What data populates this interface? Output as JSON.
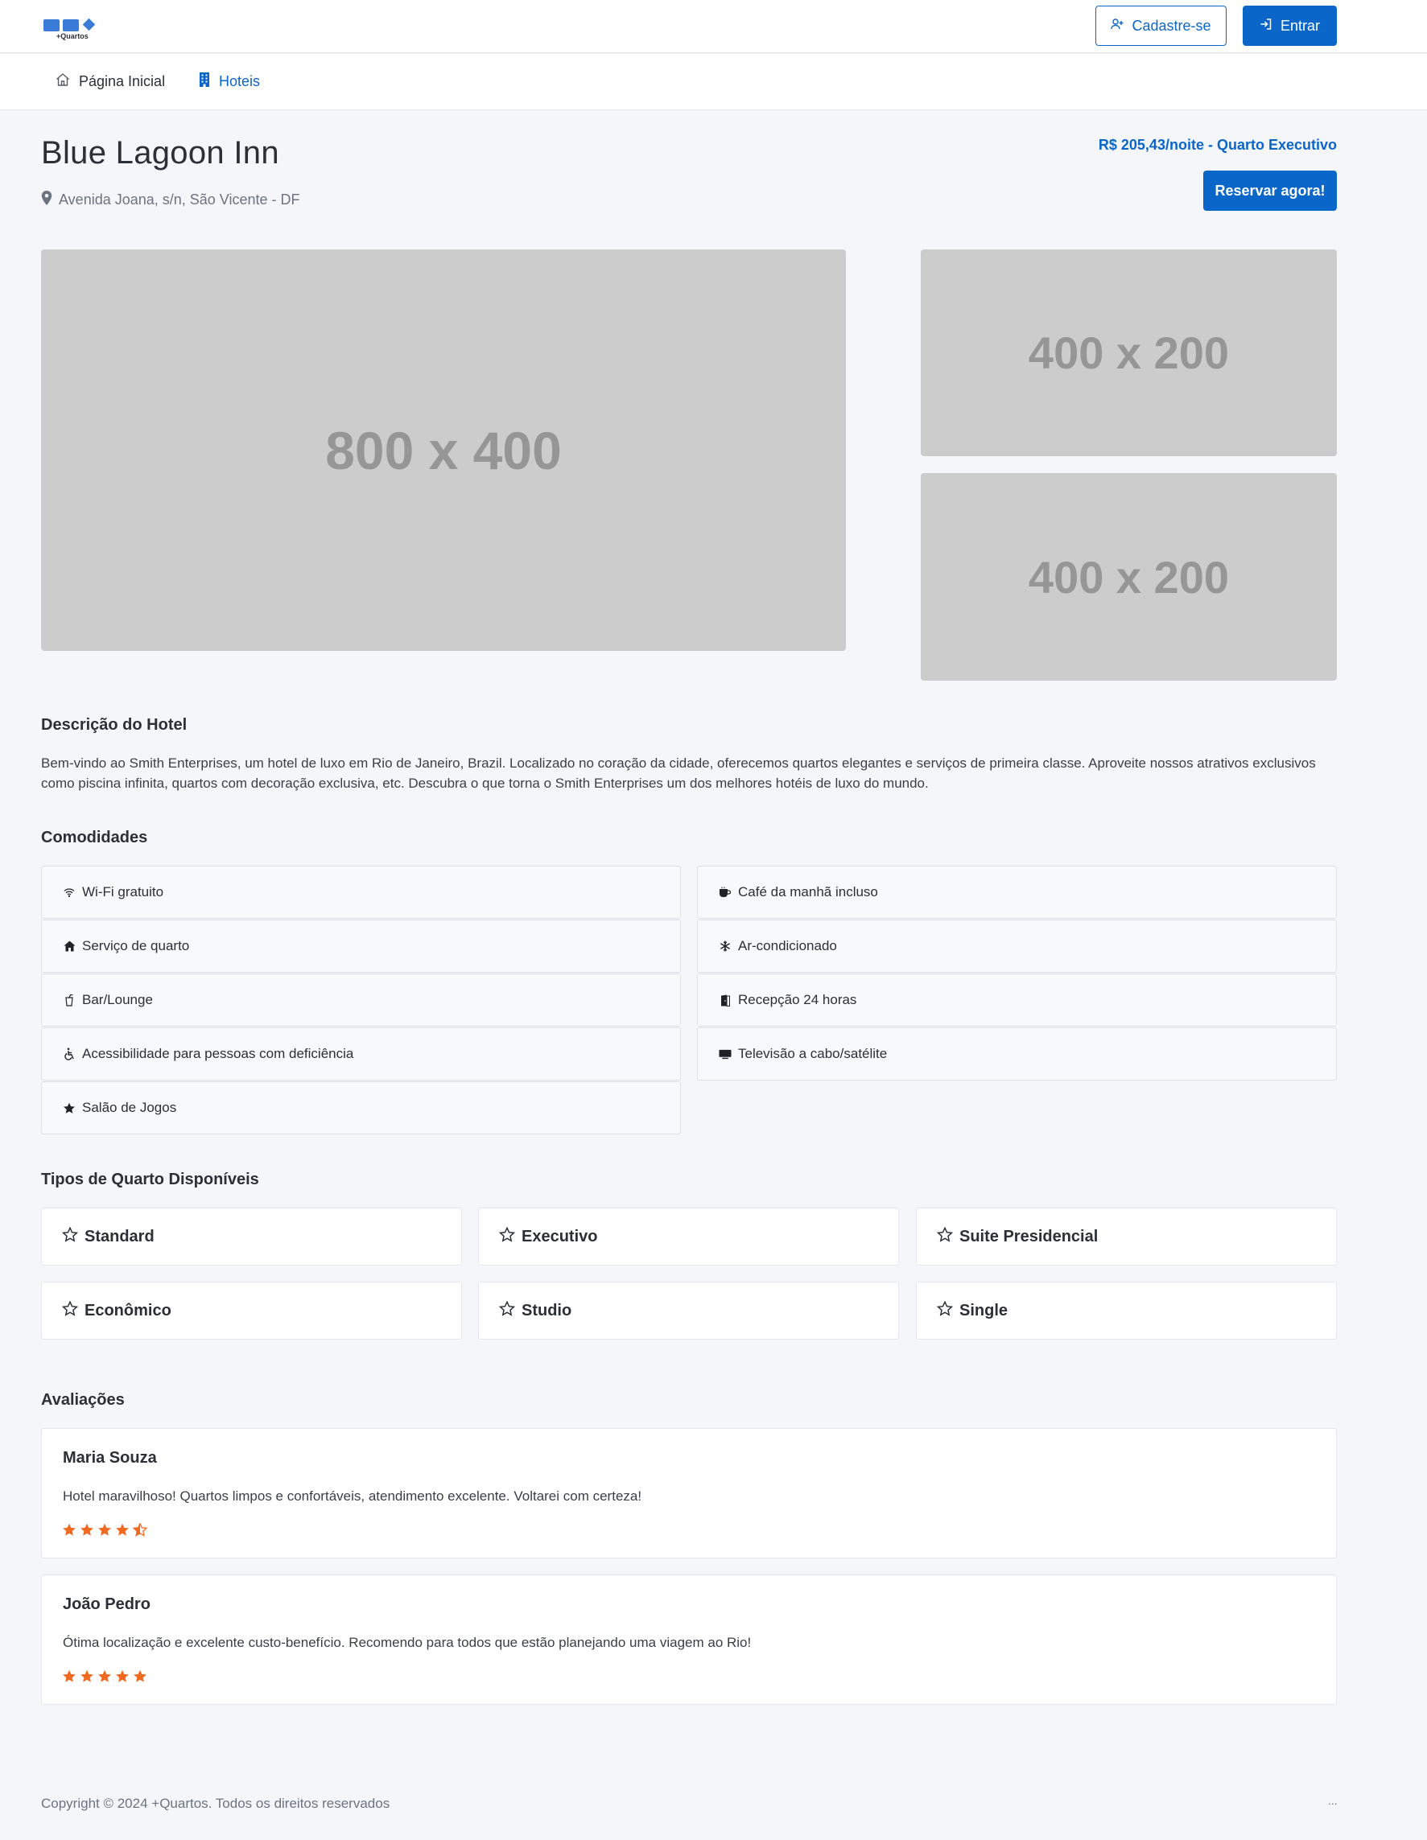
{
  "brand": {
    "logo_text": "+Quartos"
  },
  "header": {
    "signup_label": "Cadastre-se",
    "login_label": "Entrar"
  },
  "nav": {
    "home_label": "Página Inicial",
    "hotels_label": "Hoteis"
  },
  "hotel": {
    "name": "Blue Lagoon Inn",
    "address": "Avenida Joana, s/n, São Vicente - DF",
    "price": "R$ 205,43/noite - Quarto Executivo",
    "book_label": "Reservar agora!"
  },
  "gallery": {
    "main_label": "800 x 400",
    "side1_label": "400 x 200",
    "side2_label": "400 x 200"
  },
  "description": {
    "title": "Descrição do Hotel",
    "text": "Bem-vindo ao Smith Enterprises, um hotel de luxo em Rio de Janeiro, Brazil. Localizado no coração da cidade, oferecemos quartos elegantes e serviços de primeira classe. Aproveite nossos atrativos exclusivos como piscina infinita, quartos com decoração exclusiva, etc. Descubra o que torna o Smith Enterprises um dos melhores hotéis de luxo do mundo."
  },
  "amenities": {
    "title": "Comodidades",
    "items": [
      {
        "label": "Wi-Fi gratuito",
        "icon": "wifi-icon"
      },
      {
        "label": "Café da manhã incluso",
        "icon": "coffee-icon"
      },
      {
        "label": "Serviço de quarto",
        "icon": "house-icon"
      },
      {
        "label": "Ar-condicionado",
        "icon": "snowflake-icon"
      },
      {
        "label": "Bar/Lounge",
        "icon": "cup-icon"
      },
      {
        "label": "Recepção 24 horas",
        "icon": "door-icon"
      },
      {
        "label": "Acessibilidade para pessoas com deficiência",
        "icon": "accessibility-icon"
      },
      {
        "label": "Televisão a cabo/satélite",
        "icon": "tv-icon"
      },
      {
        "label": "Salão de Jogos",
        "icon": "star-icon"
      }
    ]
  },
  "rooms": {
    "title": "Tipos de Quarto Disponíveis",
    "items": [
      {
        "label": "Standard"
      },
      {
        "label": "Executivo"
      },
      {
        "label": "Suite Presidencial"
      },
      {
        "label": "Econômico"
      },
      {
        "label": "Studio"
      },
      {
        "label": "Single"
      }
    ]
  },
  "reviews": {
    "title": "Avaliações",
    "items": [
      {
        "name": "Maria Souza",
        "text": "Hotel maravilhoso! Quartos limpos e confortáveis, atendimento excelente. Voltarei com certeza!",
        "rating": 4.5
      },
      {
        "name": "João Pedro",
        "text": "Ótima localização e excelente custo-benefício. Recomendo para todos que estão planejando uma viagem ao Rio!",
        "rating": 5
      }
    ]
  },
  "footer": {
    "copyright": "Copyright © 2024 +Quartos. Todos os direitos reservados",
    "dots": "..."
  },
  "colors": {
    "primary": "#0a66c8",
    "star": "#f26a21",
    "placeholder": "#cccccc"
  }
}
